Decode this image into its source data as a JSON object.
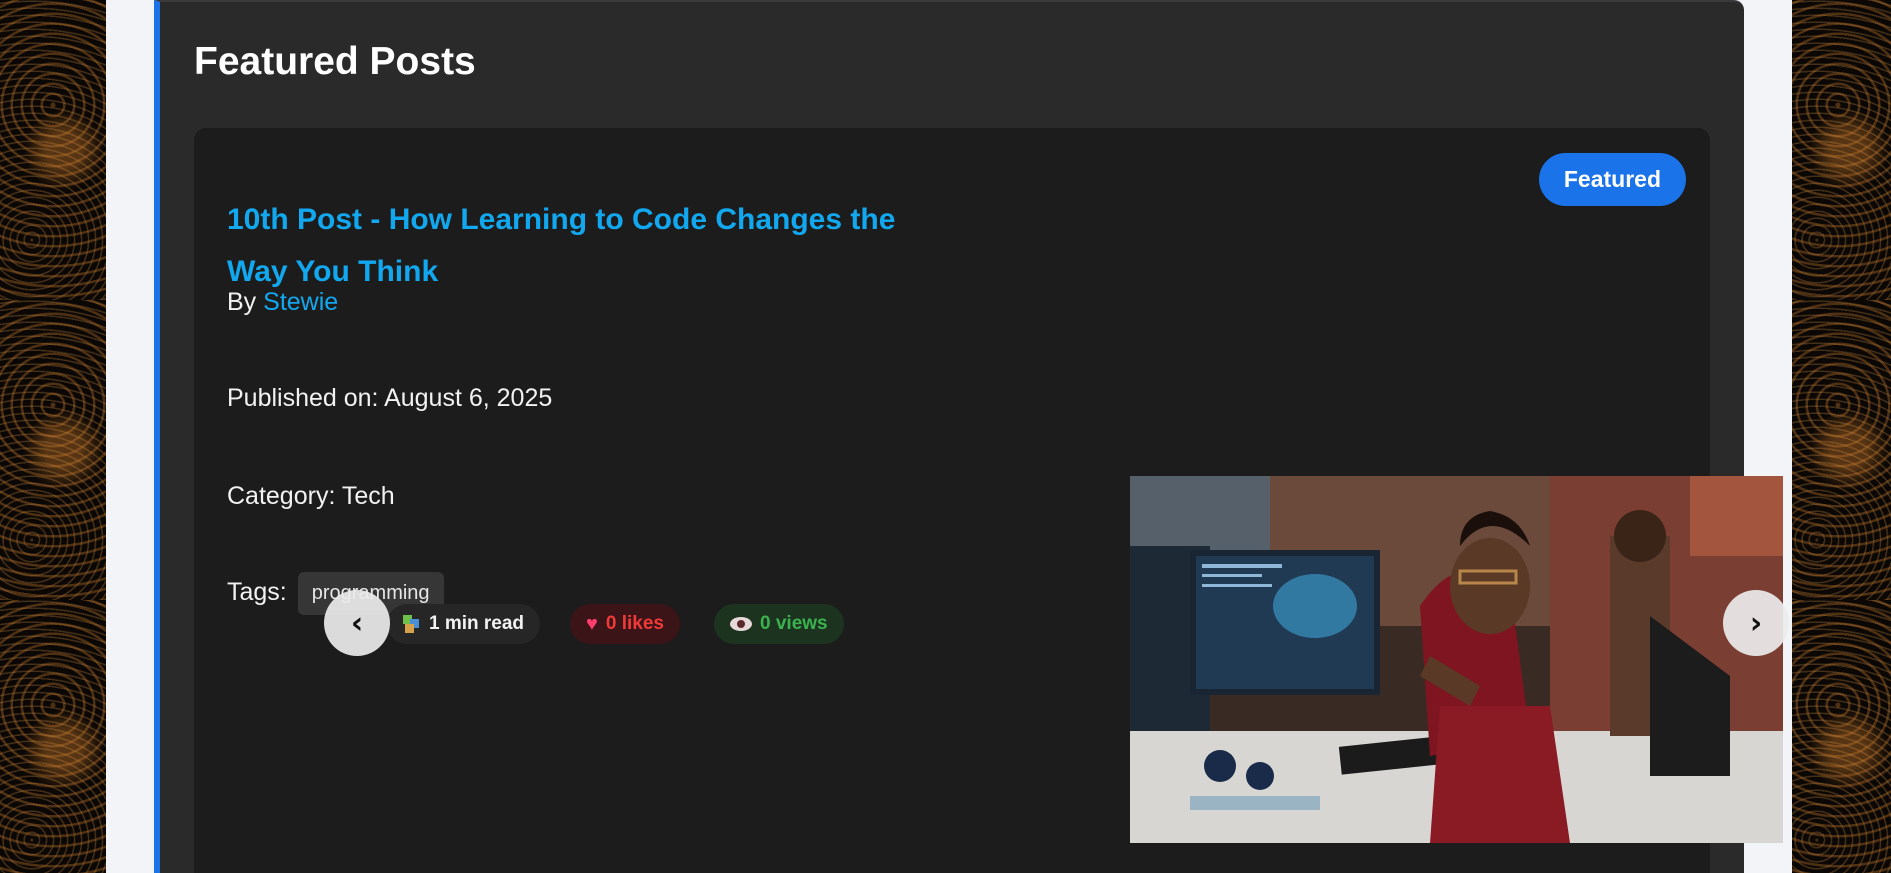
{
  "section": {
    "title": "Featured Posts"
  },
  "post": {
    "badge": "Featured",
    "title": "10th Post - How Learning to Code Changes the Way You Think",
    "by_label": "By",
    "author": "Stewie",
    "published": "Published on: August 6, 2025",
    "category": "Category: Tech",
    "tags_label": "Tags:",
    "tags": [
      "programming"
    ],
    "stats": {
      "read": "1 min read",
      "likes": "0 likes",
      "views": "0 views"
    }
  },
  "carousel": {
    "prev": "‹",
    "next": "›"
  },
  "colors": {
    "accent": "#1a73e8",
    "link": "#12a8f0",
    "likes": "#f03a3a",
    "views": "#3cb24f"
  },
  "icons": [
    "books-icon",
    "heart-icon",
    "eye-icon",
    "chevron-left-icon",
    "chevron-right-icon"
  ]
}
